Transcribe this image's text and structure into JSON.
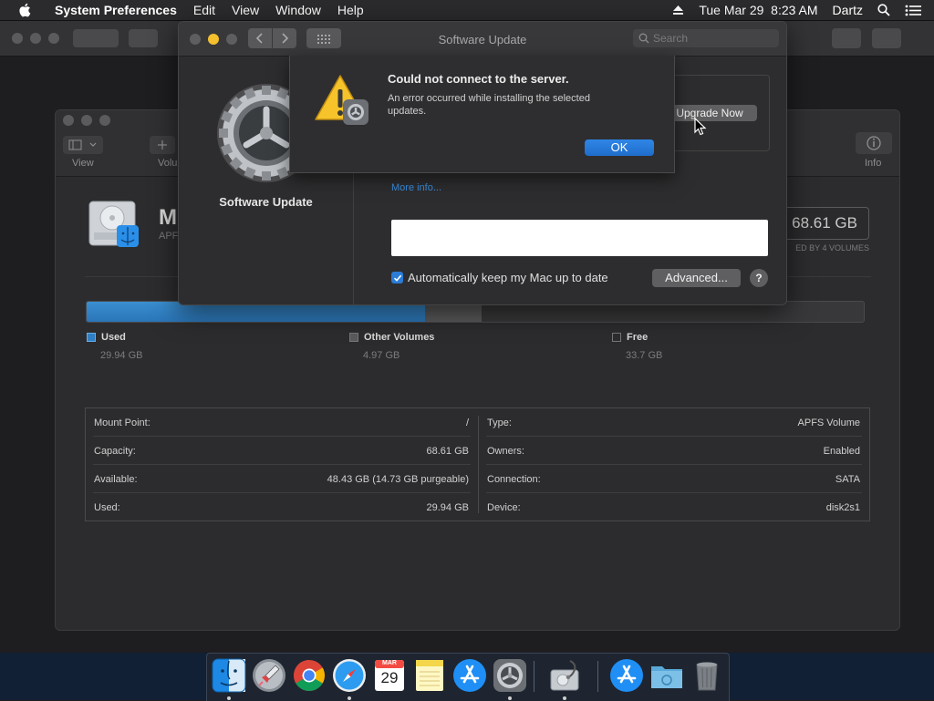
{
  "menubar": {
    "app_name": "System Preferences",
    "items": [
      "Edit",
      "View",
      "Window",
      "Help"
    ],
    "datetime": "Tue Mar 29  8:23 AM",
    "user": "Dartz"
  },
  "software_update": {
    "title": "Software Update",
    "search_placeholder": "Search",
    "pane_title": "Software Update",
    "upgrade_button": "Upgrade Now",
    "more_info": "More info...",
    "auto_update_label": "Automatically keep my Mac up to date",
    "auto_update_checked": true,
    "advanced_button": "Advanced...",
    "help_button": "?"
  },
  "alert": {
    "title": "Could not connect to the server.",
    "message": "An error occurred while installing the selected updates.",
    "ok_button": "OK"
  },
  "disk_utility": {
    "toolbar": {
      "view_label": "View",
      "volume_label": "Volu",
      "info_label": "Info"
    },
    "volume_name": "M",
    "volume_sub": "APF",
    "capacity_display": "68.61 GB",
    "capacity_sub": "ED BY 4 VOLUMES",
    "usage": {
      "used_fraction": 0.436,
      "other_fraction": 0.072,
      "used_label": "Used",
      "used_value": "29.94 GB",
      "other_label": "Other Volumes",
      "other_value": "4.97 GB",
      "free_label": "Free",
      "free_value": "33.7 GB",
      "used_color": "#2f80c4",
      "other_color": "#5a5a5c"
    },
    "info_left": [
      {
        "key": "Mount Point:",
        "value": "/"
      },
      {
        "key": "Capacity:",
        "value": "68.61 GB"
      },
      {
        "key": "Available:",
        "value": "48.43 GB (14.73 GB purgeable)"
      },
      {
        "key": "Used:",
        "value": "29.94 GB"
      }
    ],
    "info_right": [
      {
        "key": "Type:",
        "value": "APFS Volume"
      },
      {
        "key": "Owners:",
        "value": "Enabled"
      },
      {
        "key": "Connection:",
        "value": "SATA"
      },
      {
        "key": "Device:",
        "value": "disk2s1"
      }
    ]
  },
  "dock": {
    "calendar_month": "MAR",
    "calendar_day": "29",
    "icons": [
      "finder-icon",
      "launchpad-icon",
      "chrome-icon",
      "safari-icon",
      "calendar-icon",
      "notes-icon",
      "app-store-icon",
      "system-preferences-icon",
      "disk-utility-icon",
      "app-store-downloads-icon",
      "folder-icon",
      "trash-icon"
    ]
  }
}
